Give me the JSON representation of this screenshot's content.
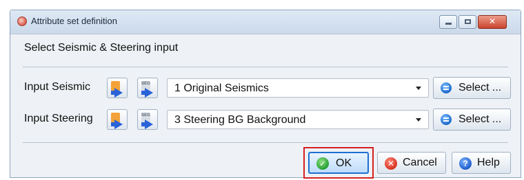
{
  "window": {
    "title": "Attribute set definition",
    "controls": {
      "minimize_icon": "minimize-icon",
      "maximize_icon": "maximize-icon",
      "close_icon": "close-icon",
      "close_glyph": "✕"
    }
  },
  "section": {
    "label": "Select Seismic & Steering input"
  },
  "rows": [
    {
      "label": "Input Seismic",
      "icon_1": "import-file-icon",
      "icon_2": "import-segy-icon",
      "icon_2_text": "SEG",
      "combo_value": "1 Original Seismics",
      "select_label": "Select ..."
    },
    {
      "label": "Input Steering",
      "icon_1": "import-file-icon",
      "icon_2": "import-segy-icon",
      "icon_2_text": "SEG",
      "combo_value": "3 Steering BG Background",
      "select_label": "Select ..."
    }
  ],
  "footer": {
    "ok_label": "OK",
    "cancel_label": "Cancel",
    "help_label": "Help",
    "help_glyph": "?",
    "cancel_glyph": "✕",
    "ok_glyph": "✓"
  },
  "colors": {
    "highlight_outline": "#d61f1f",
    "accent": "#1c6fd1",
    "titlebar": "#cbd9ea"
  }
}
